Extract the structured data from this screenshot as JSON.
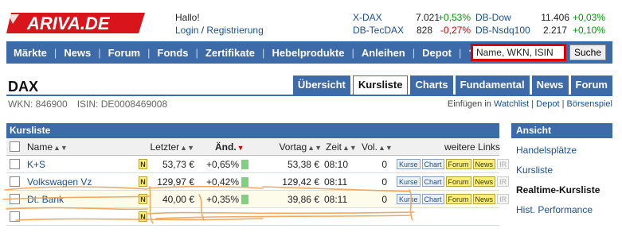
{
  "header": {
    "logo_text": "ARIVA.DE",
    "greeting": "Hallo!",
    "login": "Login",
    "separator": "/",
    "register": "Registrierung"
  },
  "tickers": [
    {
      "name": "X-DAX",
      "value": "7.021",
      "change": "+0,53%",
      "dir": "pos"
    },
    {
      "name": "DB-Dow",
      "value": "11.406",
      "change": "+0,03%",
      "dir": "pos"
    },
    {
      "name": "DB-TecDAX",
      "value": "828",
      "change": "-0,27%",
      "dir": "neg"
    },
    {
      "name": "DB-Nsdq100",
      "value": "2.217",
      "change": "+0,10%",
      "dir": "pos"
    }
  ],
  "nav": {
    "items": [
      "Märkte",
      "News",
      "Forum",
      "Fonds",
      "Zertifikate",
      "Hebelprodukte",
      "Anleihen",
      "Depot",
      "?"
    ],
    "search_value": "Name, WKN, ISIN",
    "search_button": "Suche"
  },
  "page": {
    "title": "DAX",
    "wkn": "WKN: 846900",
    "isin": "ISIN: DE0008469008",
    "tabs": [
      "Übersicht",
      "Kursliste",
      "Charts",
      "Fundamental",
      "News",
      "Forum"
    ],
    "active_tab": "Kursliste",
    "watch_prefix": "Einfügen in",
    "watch_links": [
      "Watchlist",
      "Depot",
      "Börsenspiel"
    ],
    "watch_sep": "|"
  },
  "kursliste": {
    "title": "Kursliste",
    "columns": {
      "name": "Name",
      "last": "Letzter",
      "change": "Änd.",
      "prev": "Vortag",
      "time": "Zeit",
      "vol": "Vol.",
      "links": "weitere Links"
    },
    "rows": [
      {
        "name": "K+S",
        "n": "N",
        "last": "53,73 €",
        "change": "+0,65%",
        "prev": "53,38 €",
        "time": "08:10",
        "vol": "0"
      },
      {
        "name": "Volkswagen Vz",
        "n": "N",
        "last": "129,97 €",
        "change": "+0,42%",
        "prev": "129,42 €",
        "time": "08:11",
        "vol": "0"
      },
      {
        "name": "Dt. Bank",
        "n": "N",
        "last": "40,00 €",
        "change": "+0,35%",
        "prev": "39,86 €",
        "time": "08:11",
        "vol": "0"
      },
      {
        "name": "",
        "n": "N",
        "last": "",
        "change": "",
        "prev": "",
        "time": "",
        "vol": ""
      }
    ],
    "row_links": [
      "Kurse",
      "Chart",
      "Forum",
      "News",
      "IR"
    ]
  },
  "ansicht": {
    "title": "Ansicht",
    "items": [
      "Handelsplätze",
      "Kursliste",
      "Realtime-Kursliste",
      "Hist. Performance"
    ],
    "active": "Realtime-Kursliste"
  },
  "colors": {
    "brand_blue": "#3d6aa8",
    "logo_red": "#d9141b",
    "positive": "#009900",
    "negative": "#cc0000",
    "annotation_orange": "#f0a050"
  }
}
